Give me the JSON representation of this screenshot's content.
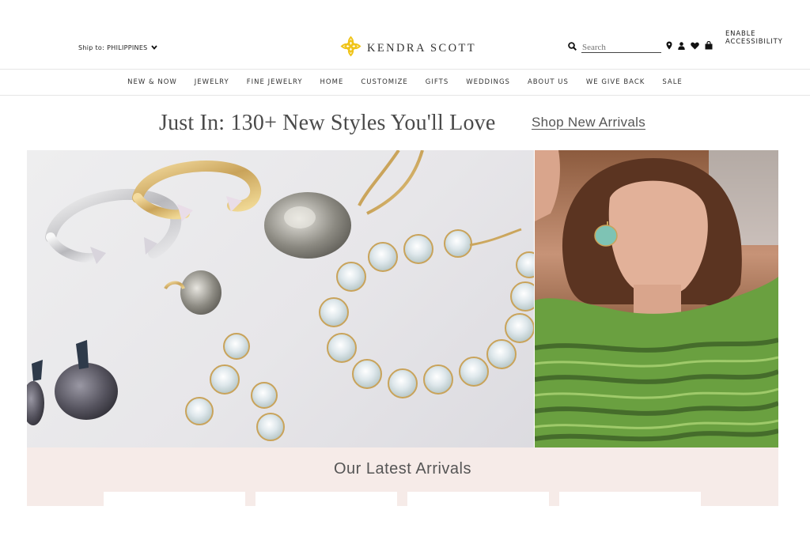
{
  "header": {
    "accessibility_label": "ENABLE ACCESSIBILITY",
    "ship_label": "Ship to:",
    "ship_country": "PHILIPPINES",
    "brand_name": "KENDRA SCOTT",
    "search_placeholder": "Search",
    "icons": [
      "search-icon",
      "location-pin-icon",
      "account-icon",
      "heart-icon",
      "shopping-bag-icon"
    ],
    "brand_color": "#f0c419"
  },
  "nav": {
    "items": [
      "NEW & NOW",
      "JEWELRY",
      "FINE JEWELRY",
      "HOME",
      "CUSTOMIZE",
      "GIFTS",
      "WEDDINGS",
      "ABOUT US",
      "WE GIVE BACK",
      "SALE"
    ]
  },
  "promo": {
    "headline": "Just In: 130+ New Styles You'll Love",
    "cta": "Shop New Arrivals"
  },
  "arrivals": {
    "title": "Our Latest Arrivals",
    "card_count": 4
  }
}
